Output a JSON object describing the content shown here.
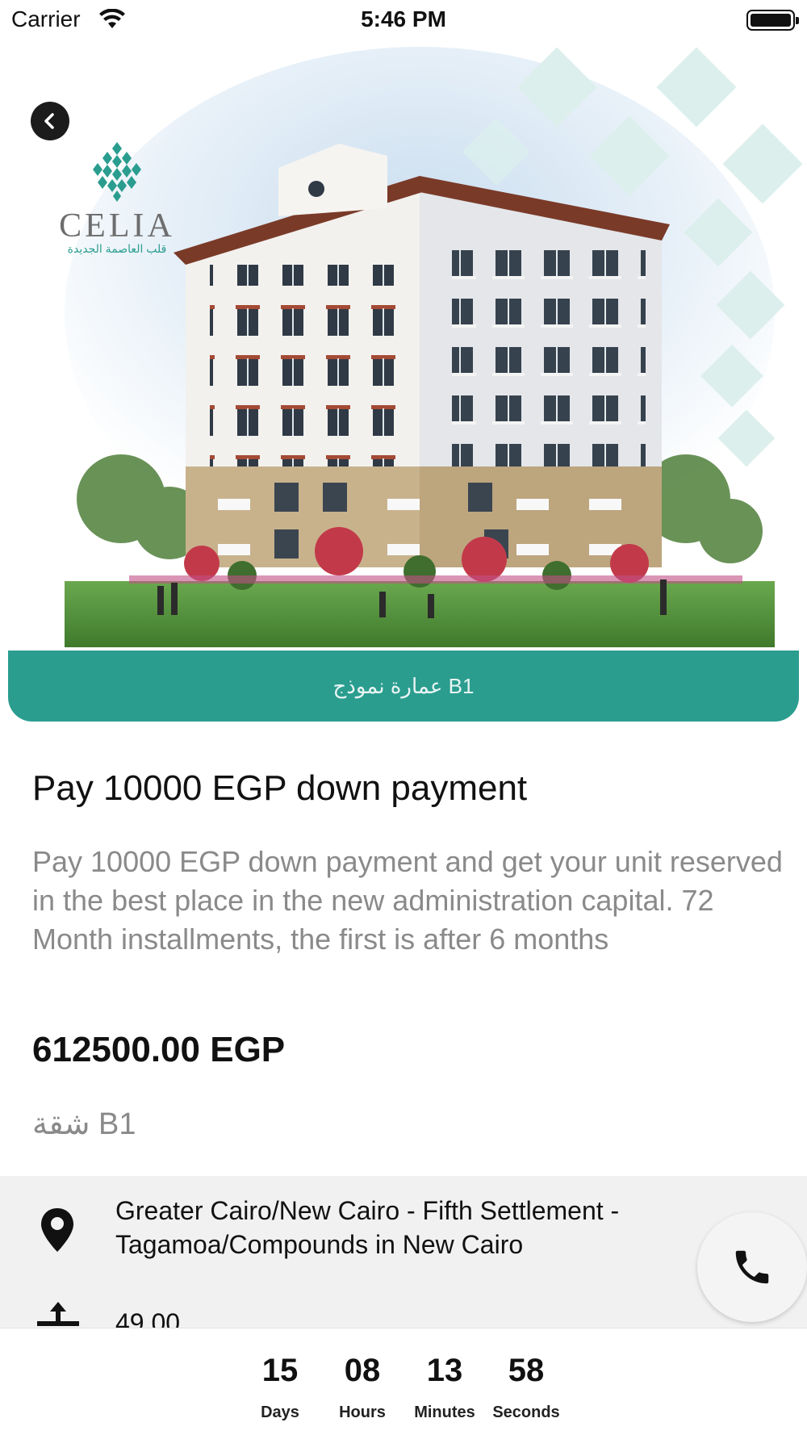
{
  "status_bar": {
    "carrier": "Carrier",
    "time": "5:46 PM"
  },
  "hero": {
    "logo_word": "CELIA",
    "logo_subtitle": "قلب العاصمة الجديدة"
  },
  "building_label": "عمارة نموذج B1",
  "offer": {
    "title": "Pay 10000 EGP down payment",
    "description": "Pay 10000 EGP down payment and get your unit reserved in the best place in the new administration capital. 72 Month installments, the first is after 6 months",
    "price": "612500.00 EGP",
    "unit_name": "شقة B1"
  },
  "info": {
    "location": "Greater Cairo/New Cairo - Fifth Settlement - Tagamoa/Compounds in New Cairo",
    "area": "49.00"
  },
  "countdown": [
    {
      "value": "15",
      "label": "Days"
    },
    {
      "value": "08",
      "label": "Hours"
    },
    {
      "value": "13",
      "label": "Minutes"
    },
    {
      "value": "58",
      "label": "Seconds"
    }
  ],
  "colors": {
    "accent": "#2a9d8f",
    "panel": "#f1f1f1",
    "muted_text": "#8a8a8a"
  },
  "icons": [
    "back-icon",
    "location-pin-icon",
    "area-icon",
    "phone-icon",
    "wifi-icon",
    "battery-icon"
  ]
}
